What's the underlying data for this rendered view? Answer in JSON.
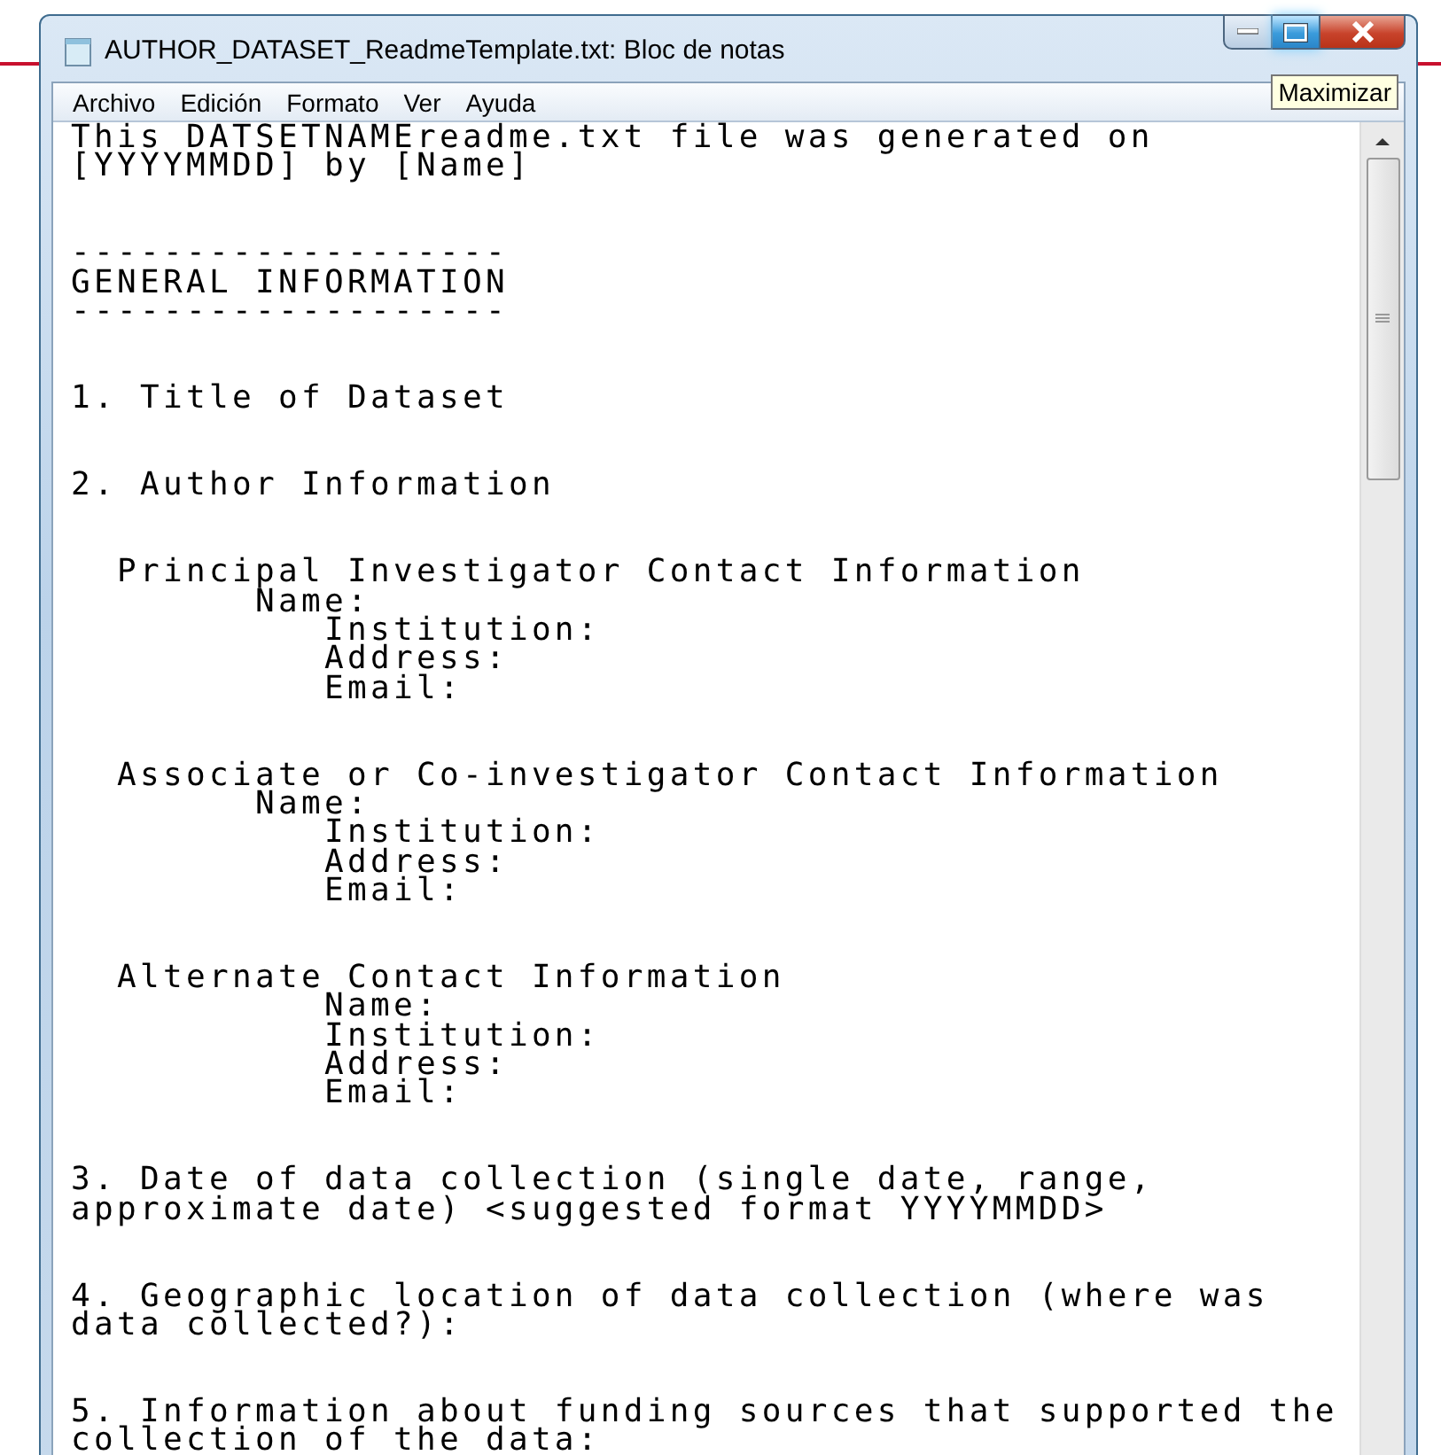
{
  "window": {
    "title": "AUTHOR_DATASET_ReadmeTemplate.txt: Bloc de notas",
    "buttons": [
      {
        "kind": "minimize",
        "hovered": false
      },
      {
        "kind": "maximize",
        "hovered": true
      },
      {
        "kind": "close",
        "hovered": false
      }
    ],
    "tooltip": "Maximizar"
  },
  "menu": [
    "Archivo",
    "Edición",
    "Formato",
    "Ver",
    "Ayuda"
  ],
  "document": {
    "blocks": [
      {
        "lines": [
          "This DATSETNAMEreadme.txt file was generated on",
          "[YYYYMMDD] by [Name]"
        ]
      },
      {
        "lines": [
          "-------------------",
          "GENERAL INFORMATION",
          "-------------------"
        ]
      },
      {
        "lines": [
          "1. Title of Dataset"
        ]
      },
      {
        "lines": [
          "2. Author Information"
        ]
      },
      {
        "lines": [
          "  Principal Investigator Contact Information",
          "        Name:",
          "           Institution:",
          "           Address:",
          "           Email:"
        ]
      },
      {
        "lines": [
          "  Associate or Co-investigator Contact Information",
          "        Name:",
          "           Institution:",
          "           Address:",
          "           Email:"
        ]
      },
      {
        "lines": [
          "  Alternate Contact Information",
          "           Name:",
          "           Institution:",
          "           Address:",
          "           Email:"
        ]
      },
      {
        "lines": [
          "3. Date of data collection (single date, range,",
          "approximate date) <suggested format YYYYMMDD>"
        ]
      },
      {
        "lines": [
          "4. Geographic location of data collection (where was",
          "data collected?):"
        ]
      },
      {
        "lines": [
          "5. Information about funding sources that supported the",
          "collection of the data:"
        ]
      }
    ]
  }
}
